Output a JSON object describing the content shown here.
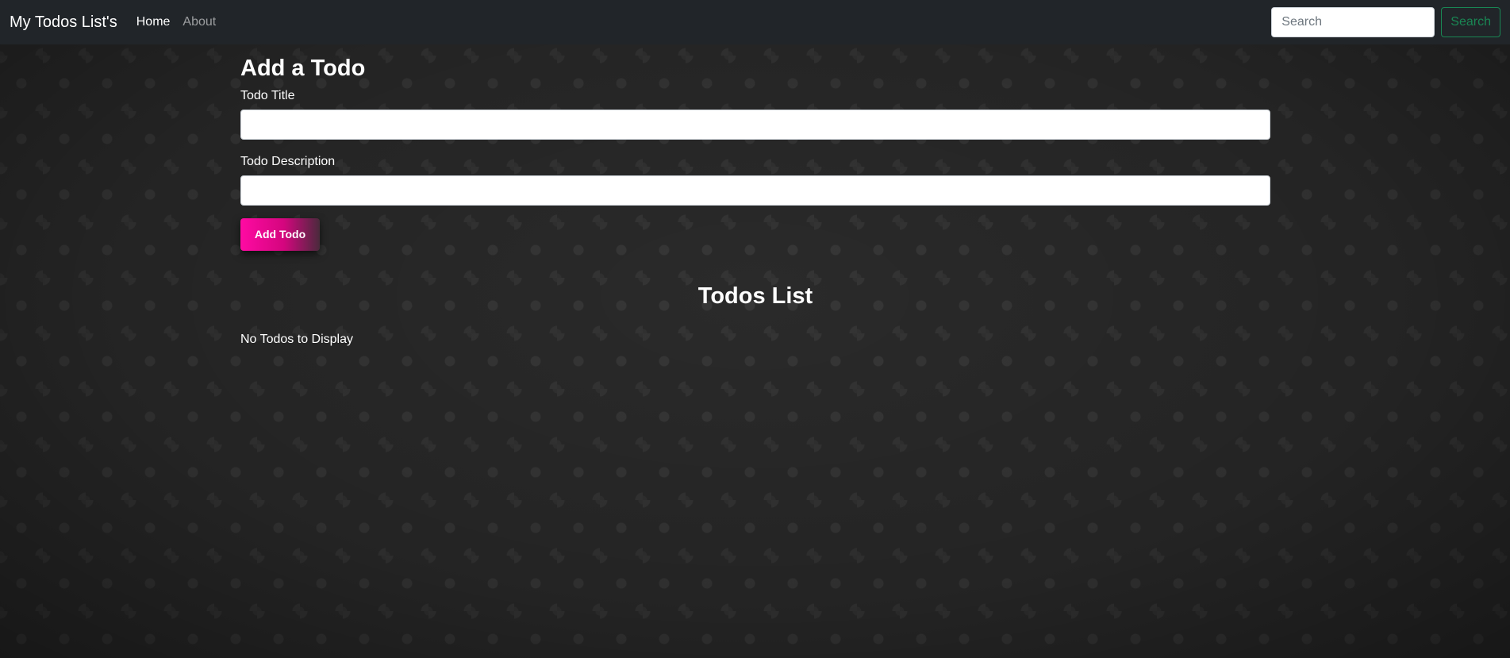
{
  "navbar": {
    "brand": "My Todos List's",
    "links": [
      {
        "label": "Home",
        "active": true
      },
      {
        "label": "About",
        "active": false
      }
    ],
    "search": {
      "placeholder": "Search",
      "value": "",
      "button_label": "Search"
    }
  },
  "form": {
    "heading": "Add a Todo",
    "title_label": "Todo Title",
    "title_value": "",
    "description_label": "Todo Description",
    "description_value": "",
    "submit_label": "Add Todo"
  },
  "todos": {
    "heading": "Todos List",
    "empty_message": "No Todos to Display",
    "items": []
  },
  "colors": {
    "navbar_bg": "#212529",
    "search_button": "#198754",
    "add_button_gradient": [
      "#ff0aa3",
      "#4a2a3c"
    ]
  }
}
